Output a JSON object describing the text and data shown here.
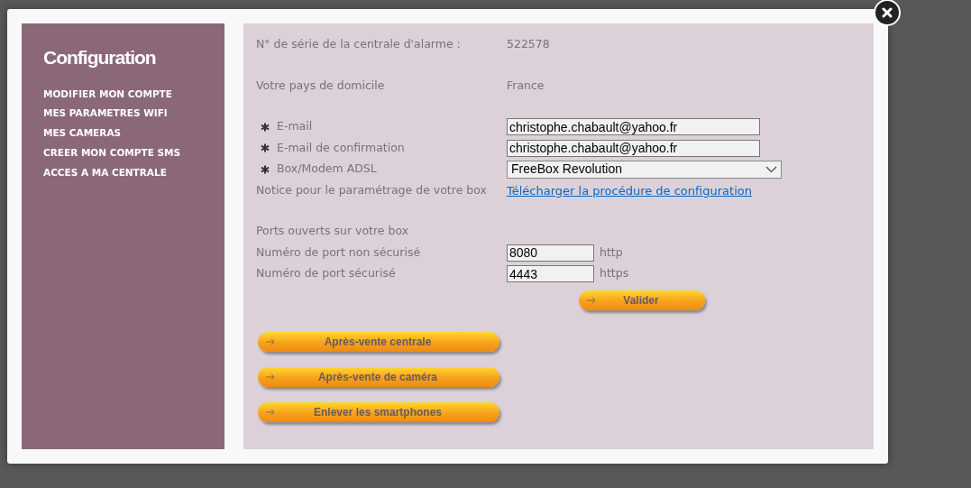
{
  "sidebar": {
    "title": "Configuration",
    "items": [
      {
        "label": "MODIFIER MON COMPTE"
      },
      {
        "label": "MES PARAMETRES WIFI"
      },
      {
        "label": "MES CAMERAS"
      },
      {
        "label": "CREER MON COMPTE SMS"
      },
      {
        "label": "ACCES A MA CENTRALE"
      }
    ]
  },
  "groups": [
    {
      "rows": [
        {
          "kind": "static",
          "label": "N° de série de la centrale d'alarme :",
          "value": "522578",
          "required": false
        }
      ]
    },
    {
      "rows": [
        {
          "kind": "static",
          "label": "Votre pays de domicile",
          "value": "France",
          "required": false
        }
      ]
    },
    {
      "rows": [
        {
          "kind": "input",
          "label": "E-mail",
          "value": "christophe.chabault@yahoo.fr",
          "required": true
        },
        {
          "kind": "input",
          "label": "E-mail de confirmation",
          "value": "christophe.chabault@yahoo.fr",
          "required": true
        },
        {
          "kind": "select",
          "label": "Box/Modem ADSL",
          "value": "FreeBox Revolution",
          "required": true
        },
        {
          "kind": "link",
          "label": "Notice pour le paramétrage de votre box",
          "value": "Télécharger la procédure de configuration",
          "required": false
        }
      ]
    },
    {
      "heading": "Ports ouverts sur votre box",
      "rows": [
        {
          "kind": "port",
          "label": "Numéro de port non sécurisé",
          "value": "8080",
          "unit": "http",
          "required": false
        },
        {
          "kind": "port",
          "label": "Numéro de port sécurisé",
          "value": "4443",
          "unit": "https",
          "required": false
        }
      ]
    }
  ],
  "submit": "Valider",
  "buttons": [
    "Après-vente centrale",
    "Après-vente de caméra",
    "Enlever les smartphones"
  ]
}
